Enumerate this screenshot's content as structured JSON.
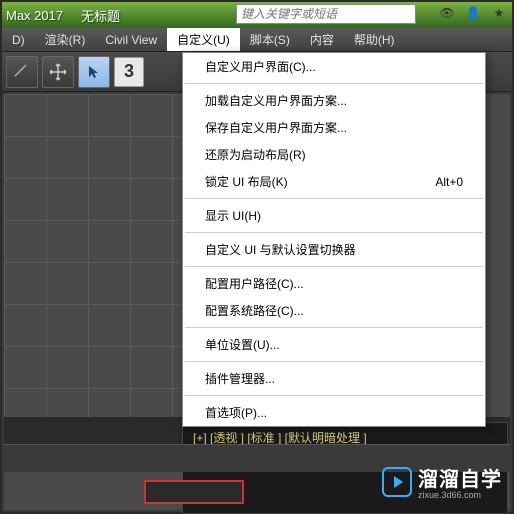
{
  "title": {
    "app": "Max 2017",
    "doc": "无标题",
    "search_placeholder": "键入关键字或短语"
  },
  "menu": {
    "items": [
      "D)",
      "渲染(R)",
      "Civil View",
      "自定义(U)",
      "脚本(S)",
      "内容",
      "帮助(H)"
    ],
    "active_index": 3
  },
  "toolbar": {
    "number": "3"
  },
  "dropdown": {
    "groups": [
      [
        {
          "label": "自定义用户界面(C)..."
        }
      ],
      [
        {
          "label": "加载自定义用户界面方案..."
        },
        {
          "label": "保存自定义用户界面方案..."
        },
        {
          "label": "还原为启动布局(R)"
        },
        {
          "label": "锁定 UI 布局(K)",
          "shortcut": "Alt+0"
        }
      ],
      [
        {
          "label": "显示 UI(H)"
        }
      ],
      [
        {
          "label": "自定义 UI 与默认设置切换器"
        }
      ],
      [
        {
          "label": "配置用户路径(C)..."
        },
        {
          "label": "配置系统路径(C)..."
        }
      ],
      [
        {
          "label": "单位设置(U)..."
        }
      ],
      [
        {
          "label": "插件管理器..."
        }
      ],
      [
        {
          "label": "首选项(P)..."
        }
      ]
    ]
  },
  "status": {
    "text": "[+] [透视 ] [标准 ] [默认明暗处理 ]"
  },
  "watermark": {
    "cn": "溜溜自学",
    "url": "zixue.3d66.com"
  }
}
